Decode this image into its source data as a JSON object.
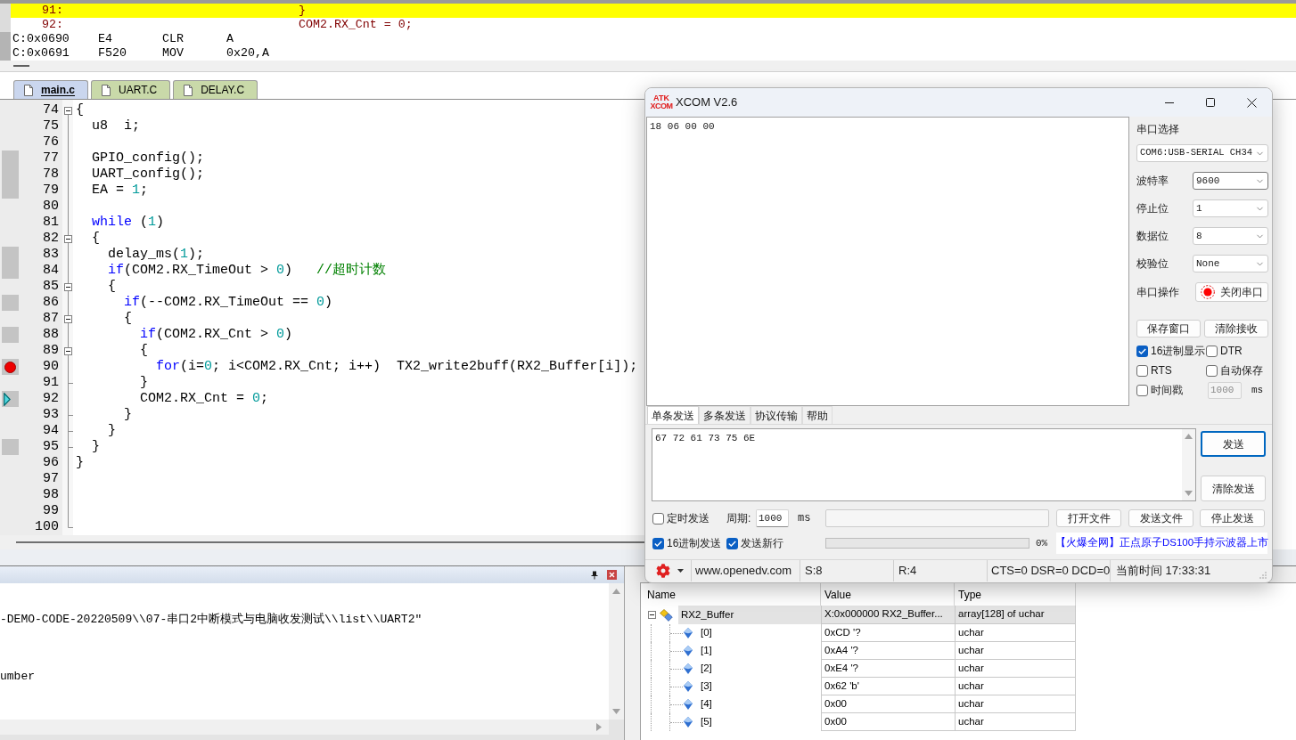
{
  "disassembly": {
    "rows": [
      {
        "kind": "source",
        "line": "91:",
        "code": "}",
        "highlighted": true
      },
      {
        "kind": "source",
        "line": "92:",
        "code": "COM2.RX_Cnt = 0;",
        "highlighted": false
      },
      {
        "kind": "asm",
        "address": "C:0x0690",
        "opcode": "E4",
        "mnemonic": "CLR",
        "operands": "A",
        "highlighted": false
      },
      {
        "kind": "asm",
        "address": "C:0x0691",
        "opcode": "F520",
        "mnemonic": "MOV",
        "operands": "0x20,A",
        "highlighted": false
      }
    ]
  },
  "file_tabs": [
    {
      "label": "main.c",
      "selected": true
    },
    {
      "label": "UART.C",
      "selected": false
    },
    {
      "label": "DELAY.C",
      "selected": false
    }
  ],
  "editor": {
    "lines": [
      {
        "number": "74",
        "kind": "fold",
        "executable": false,
        "breakpoint": false,
        "current": false,
        "tokens": [
          {
            "kind": "plain",
            "text": "{"
          }
        ]
      },
      {
        "number": "75",
        "kind": "plain",
        "executable": false,
        "breakpoint": false,
        "current": false,
        "tokens": [
          {
            "kind": "plain",
            "text": "  u8  i;"
          }
        ]
      },
      {
        "number": "76",
        "kind": "plain",
        "executable": false,
        "breakpoint": false,
        "current": false
      },
      {
        "number": "77",
        "kind": "plain",
        "executable": true,
        "breakpoint": false,
        "current": false,
        "tokens": [
          {
            "kind": "plain",
            "text": "  GPIO_config();"
          }
        ]
      },
      {
        "number": "78",
        "kind": "plain",
        "executable": true,
        "breakpoint": false,
        "current": false,
        "tokens": [
          {
            "kind": "plain",
            "text": "  UART_config();"
          }
        ]
      },
      {
        "number": "79",
        "kind": "plain",
        "executable": true,
        "breakpoint": false,
        "current": false,
        "tokens": [
          {
            "kind": "plain",
            "text": "  EA = "
          },
          {
            "kind": "number",
            "text": "1"
          },
          {
            "kind": "plain",
            "text": ";"
          }
        ]
      },
      {
        "number": "80",
        "kind": "plain",
        "executable": false,
        "breakpoint": false,
        "current": false
      },
      {
        "number": "81",
        "kind": "plain",
        "executable": false,
        "breakpoint": false,
        "current": false,
        "tokens": [
          {
            "kind": "keyword",
            "text": "  while"
          },
          {
            "kind": "plain",
            "text": " ("
          },
          {
            "kind": "number",
            "text": "1"
          },
          {
            "kind": "plain",
            "text": ")"
          }
        ]
      },
      {
        "number": "82",
        "kind": "fold",
        "executable": false,
        "breakpoint": false,
        "current": false,
        "tokens": [
          {
            "kind": "plain",
            "text": "  {"
          }
        ]
      },
      {
        "number": "83",
        "kind": "plain",
        "executable": true,
        "breakpoint": false,
        "current": false,
        "tokens": [
          {
            "kind": "plain",
            "text": "    delay_ms("
          },
          {
            "kind": "number",
            "text": "1"
          },
          {
            "kind": "plain",
            "text": ");"
          }
        ]
      },
      {
        "number": "84",
        "kind": "plain",
        "executable": true,
        "breakpoint": false,
        "current": false,
        "tokens": [
          {
            "kind": "keyword",
            "text": "    if"
          },
          {
            "kind": "plain",
            "text": "(COM2.RX_TimeOut > "
          },
          {
            "kind": "number",
            "text": "0"
          },
          {
            "kind": "plain",
            "text": ")   "
          },
          {
            "kind": "comment",
            "text": "//超时计数"
          }
        ]
      },
      {
        "number": "85",
        "kind": "fold",
        "executable": false,
        "breakpoint": false,
        "current": false,
        "tokens": [
          {
            "kind": "plain",
            "text": "    {"
          }
        ]
      },
      {
        "number": "86",
        "kind": "plain",
        "executable": true,
        "breakpoint": false,
        "current": false,
        "tokens": [
          {
            "kind": "keyword",
            "text": "      if"
          },
          {
            "kind": "plain",
            "text": "(--COM2.RX_TimeOut == "
          },
          {
            "kind": "number",
            "text": "0"
          },
          {
            "kind": "plain",
            "text": ")"
          }
        ]
      },
      {
        "number": "87",
        "kind": "fold",
        "executable": false,
        "breakpoint": false,
        "current": false,
        "tokens": [
          {
            "kind": "plain",
            "text": "      {"
          }
        ]
      },
      {
        "number": "88",
        "kind": "plain",
        "executable": true,
        "breakpoint": false,
        "current": false,
        "tokens": [
          {
            "kind": "keyword",
            "text": "        if"
          },
          {
            "kind": "plain",
            "text": "(COM2.RX_Cnt > "
          },
          {
            "kind": "number",
            "text": "0"
          },
          {
            "kind": "plain",
            "text": ")"
          }
        ]
      },
      {
        "number": "89",
        "kind": "fold",
        "executable": false,
        "breakpoint": false,
        "current": false,
        "tokens": [
          {
            "kind": "plain",
            "text": "        {"
          }
        ]
      },
      {
        "number": "90",
        "kind": "plain",
        "executable": true,
        "breakpoint": true,
        "current": false,
        "tokens": [
          {
            "kind": "keyword",
            "text": "          for"
          },
          {
            "kind": "plain",
            "text": "(i="
          },
          {
            "kind": "number",
            "text": "0"
          },
          {
            "kind": "plain",
            "text": "; i<COM2.RX_Cnt; i++)  TX2_write2buff(RX2_Buffer[i]);"
          }
        ]
      },
      {
        "number": "91",
        "kind": "foldend",
        "executable": false,
        "breakpoint": false,
        "current": false,
        "tokens": [
          {
            "kind": "plain",
            "text": "        }"
          }
        ]
      },
      {
        "number": "92",
        "kind": "plain",
        "executable": true,
        "breakpoint": false,
        "current": true,
        "tokens": [
          {
            "kind": "plain",
            "text": "        COM2.RX_Cnt = "
          },
          {
            "kind": "number",
            "text": "0"
          },
          {
            "kind": "plain",
            "text": ";"
          }
        ]
      },
      {
        "number": "93",
        "kind": "foldend",
        "executable": false,
        "breakpoint": false,
        "current": false,
        "tokens": [
          {
            "kind": "plain",
            "text": "      }"
          }
        ]
      },
      {
        "number": "94",
        "kind": "foldend",
        "executable": false,
        "breakpoint": false,
        "current": false,
        "tokens": [
          {
            "kind": "plain",
            "text": "    }"
          }
        ]
      },
      {
        "number": "95",
        "kind": "foldend",
        "executable": true,
        "breakpoint": false,
        "current": false,
        "tokens": [
          {
            "kind": "plain",
            "text": "  }"
          }
        ]
      },
      {
        "number": "96",
        "kind": "plain",
        "executable": false,
        "breakpoint": false,
        "current": false,
        "tokens": [
          {
            "kind": "plain",
            "text": "}"
          }
        ]
      },
      {
        "number": "97",
        "kind": "plain",
        "executable": false,
        "breakpoint": false,
        "current": false
      },
      {
        "number": "98",
        "kind": "plain",
        "executable": false,
        "breakpoint": false,
        "current": false
      },
      {
        "number": "99",
        "kind": "plain",
        "executable": false,
        "breakpoint": false,
        "current": false
      },
      {
        "number": "100",
        "kind": "foldend",
        "executable": false,
        "breakpoint": false,
        "current": false
      }
    ]
  },
  "build_output": {
    "lines": [
      "-DEMO-CODE-20220509\\\\07-串口2中断模式与电脑收发测试\\\\list\\\\UART2\"",
      "umber"
    ]
  },
  "watch": {
    "columns": [
      "Name",
      "Value",
      "Type"
    ],
    "rows": [
      {
        "name": "RX2_Buffer",
        "value": "X:0x000000 RX2_Buffer...",
        "type": "array[128] of uchar",
        "selected": true,
        "expanded": true,
        "children": [
          {
            "name": "[0]",
            "value": "0xCD '?",
            "type": "uchar",
            "selected": false
          },
          {
            "name": "[1]",
            "value": "0xA4 '?",
            "type": "uchar",
            "selected": false
          },
          {
            "name": "[2]",
            "value": "0xE4 '?",
            "type": "uchar",
            "selected": false
          },
          {
            "name": "[3]",
            "value": "0x62 'b'",
            "type": "uchar",
            "selected": false
          },
          {
            "name": "[4]",
            "value": "0x00",
            "type": "uchar",
            "selected": false
          },
          {
            "name": "[5]",
            "value": "0x00",
            "type": "uchar",
            "selected": false
          }
        ]
      }
    ]
  },
  "xcom": {
    "title": "XCOM V2.6",
    "logo": [
      "ATK",
      "XCOM"
    ],
    "receive_text": "18 06 00 00",
    "port": {
      "label": "串口选择",
      "value": "COM6:USB-SERIAL CH34"
    },
    "settings": [
      {
        "label": "波特率",
        "value": "9600",
        "focused": true
      },
      {
        "label": "停止位",
        "value": "1",
        "focused": false
      },
      {
        "label": "数据位",
        "value": "8",
        "focused": false
      },
      {
        "label": "校验位",
        "value": "None",
        "focused": false
      }
    ],
    "port_action": {
      "label": "串口操作",
      "button": "关闭串口",
      "open": true
    },
    "receive_buttons": [
      "保存窗口",
      "清除接收"
    ],
    "options": [
      {
        "label": "16进制显示",
        "checked": true
      },
      {
        "label": "DTR",
        "checked": false
      },
      {
        "label": "RTS",
        "checked": false
      },
      {
        "label": "自动保存",
        "checked": false
      },
      {
        "label": "时间戳",
        "checked": false
      }
    ],
    "timestamp": {
      "value": "1000",
      "unit": "ms",
      "disabled": true
    },
    "send_tabs": [
      {
        "label": "单条发送",
        "selected": true
      },
      {
        "label": "多条发送",
        "selected": false
      },
      {
        "label": "协议传输",
        "selected": false
      },
      {
        "label": "帮助",
        "selected": false
      }
    ],
    "send_text": "67 72 61 73 75 6E",
    "send_buttons": [
      {
        "label": "发送",
        "focused": true
      },
      {
        "label": "清除发送",
        "focused": false
      }
    ],
    "timed_send": {
      "label": "定时发送",
      "checked": false
    },
    "period": {
      "label": "周期:",
      "value": "1000",
      "unit": "ms"
    },
    "file_buttons": [
      "打开文件",
      "发送文件",
      "停止发送"
    ],
    "hex_send": {
      "label": "16进制发送",
      "checked": true
    },
    "send_newline": {
      "label": "发送新行",
      "checked": true
    },
    "progress": {
      "level": 0,
      "reading": "0%"
    },
    "promo_link": "【火爆全网】正点原子DS100手持示波器上市",
    "status_bar": {
      "website": "www.openedv.com",
      "sent": "S:8",
      "received": "R:4",
      "signals": "CTS=0 DSR=0 DCD=0",
      "time": "当前时间 17:33:31"
    }
  }
}
